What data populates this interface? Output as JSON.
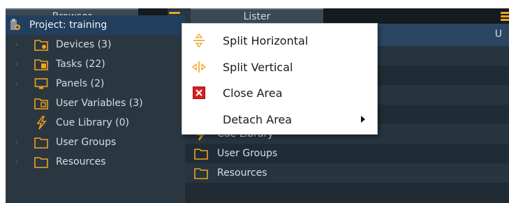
{
  "browser": {
    "title": "Browser",
    "items": [
      {
        "label": "Project: training",
        "icon": "project-icon"
      },
      {
        "label": "Devices (3)",
        "icon": "devices-folder-icon"
      },
      {
        "label": "Tasks (22)",
        "icon": "tasks-folder-icon"
      },
      {
        "label": "Panels (2)",
        "icon": "panels-icon"
      },
      {
        "label": "User Variables (3)",
        "icon": "user-variables-folder-icon"
      },
      {
        "label": "Cue Library (0)",
        "icon": "cue-library-icon"
      },
      {
        "label": "User Groups",
        "icon": "folder-icon"
      },
      {
        "label": "Resources",
        "icon": "folder-icon"
      }
    ]
  },
  "lister": {
    "title": "Lister",
    "column_hint": "U",
    "items": [
      {
        "label": "",
        "icon": ""
      },
      {
        "label": "",
        "icon": ""
      },
      {
        "label": "",
        "icon": ""
      },
      {
        "label": "",
        "icon": ""
      },
      {
        "label": "Cue Library",
        "icon": "cue-library-icon"
      },
      {
        "label": "User Groups",
        "icon": "folder-icon"
      },
      {
        "label": "Resources",
        "icon": "folder-icon"
      }
    ]
  },
  "context_menu": {
    "items": [
      {
        "label": "Split Horizontal",
        "icon": "split-horizontal-icon"
      },
      {
        "label": "Split Vertical",
        "icon": "split-vertical-icon"
      },
      {
        "label": "Close Area",
        "icon": "close-area-icon"
      },
      {
        "label": "Detach Area",
        "icon": "",
        "has_submenu": true
      }
    ]
  },
  "colors": {
    "accent_orange": "#f2a220",
    "selection_blue": "#233f5e",
    "panel_bg": "#2b3740",
    "close_red": "#d42020"
  }
}
